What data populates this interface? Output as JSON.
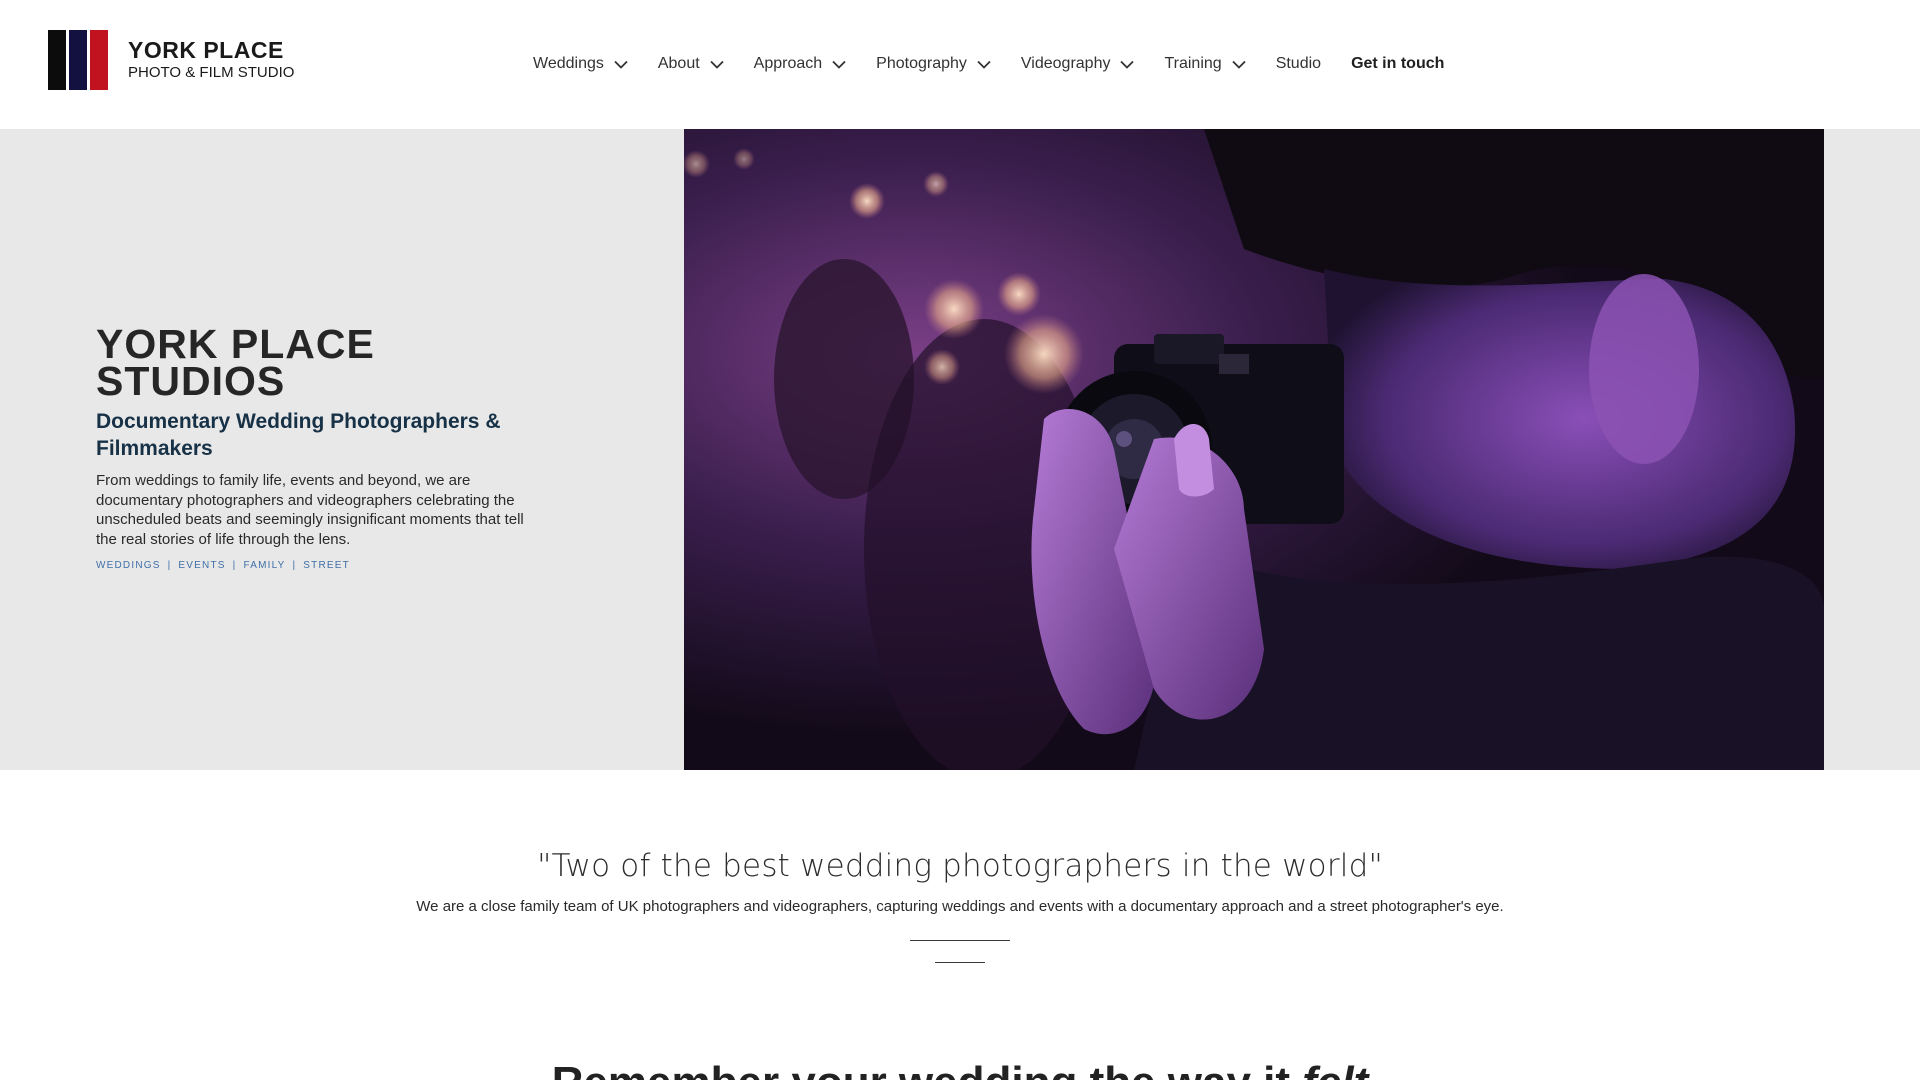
{
  "brand": {
    "name": "YORK PLACE",
    "tagline": "PHOTO & FILM STUDIO",
    "colors": {
      "black": "#0c0c0c",
      "navy": "#13113f",
      "red": "#c1121f"
    }
  },
  "nav": {
    "items": [
      {
        "label": "Weddings",
        "dropdown": true
      },
      {
        "label": "About",
        "dropdown": true
      },
      {
        "label": "Approach",
        "dropdown": true
      },
      {
        "label": "Photography",
        "dropdown": true
      },
      {
        "label": "Videography",
        "dropdown": true
      },
      {
        "label": "Training",
        "dropdown": true
      },
      {
        "label": "Studio",
        "dropdown": false
      },
      {
        "label": "Get in touch",
        "dropdown": false
      }
    ]
  },
  "hero": {
    "title": "YORK PLACE STUDIOS",
    "subtitle": "Documentary Wedding Photographers & Filmmakers",
    "description": "From weddings to family life, events and beyond, we are documentary photographers and videographers celebrating the unscheduled beats and seemingly insignificant moments that tell the real stories of life through the lens.",
    "tags": [
      "WEDDINGS",
      "EVENTS",
      "FAMILY",
      "STREET"
    ],
    "accent": "#173147",
    "tag_color": "#3f6fa8"
  },
  "quote": {
    "text": "\"Two of the best wedding photographers in the world\"",
    "intro": "We are a close family team of UK photographers and videographers, capturing weddings and events with a documentary approach and a street photographer's eye."
  },
  "next_section": {
    "heading_start": "Remember your wedding the way it ",
    "heading_emphasis": "felt"
  }
}
